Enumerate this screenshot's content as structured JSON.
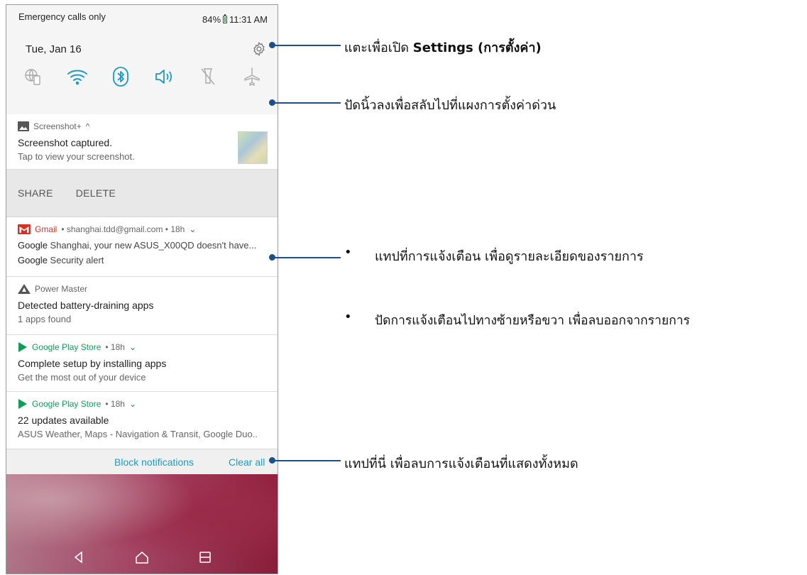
{
  "status_bar": {
    "carrier": "Emergency calls only",
    "battery_pct": "84%",
    "time": "11:31 AM"
  },
  "quick_settings": {
    "date": "Tue, Jan 16"
  },
  "notifications": {
    "screenshot": {
      "app": "Screenshot+",
      "title": "Screenshot captured.",
      "text": "Tap to view your screenshot.",
      "action_share": "SHARE",
      "action_delete": "DELETE"
    },
    "gmail": {
      "app": "Gmail",
      "meta": "• shanghai.tdd@gmail.com • 18h",
      "line1_sender": "Google",
      "line1_text": "Shanghai, your new ASUS_X00QD doesn't have...",
      "line2_sender": "Google",
      "line2_text": "Security alert"
    },
    "power_master": {
      "app": "Power Master",
      "title": "Detected battery-draining apps",
      "text": "1 apps found"
    },
    "play_store_1": {
      "app": "Google Play Store",
      "meta": "• 18h",
      "title": "Complete setup by installing apps",
      "text": "Get the most out of your device"
    },
    "play_store_2": {
      "app": "Google Play Store",
      "meta": "• 18h",
      "title": "22 updates available",
      "text": "ASUS Weather, Maps - Navigation & Transit, Google Duo.."
    }
  },
  "footer": {
    "block": "Block notifications",
    "clear_all": "Clear all"
  },
  "annotations": {
    "settings_prefix": "แตะเพื่อเปิด",
    "settings_bold": "Settings (การตั้งค่า)",
    "swipe_down": "ปัดนิ้วลงเพื่อสลับไปที่แผงการตั้งค่าด่วน",
    "tap_notification": "แทปที่การแจ้งเตือน เพื่อดูรายละเอียดของรายการ",
    "swipe_notification": "ปัดการแจ้งเตือนไปทางซ้ายหรือขวา เพื่อลบออกจากรายการ",
    "clear_all_hint": "แทปที่นี่ เพื่อลบการแจ้งเตือนที่แสดงทั้งหมด"
  },
  "colors": {
    "accent": "#1a9bc9",
    "annotation": "#1d4f8c",
    "gmail": "#d93025",
    "play_store": "#0f9d58"
  }
}
